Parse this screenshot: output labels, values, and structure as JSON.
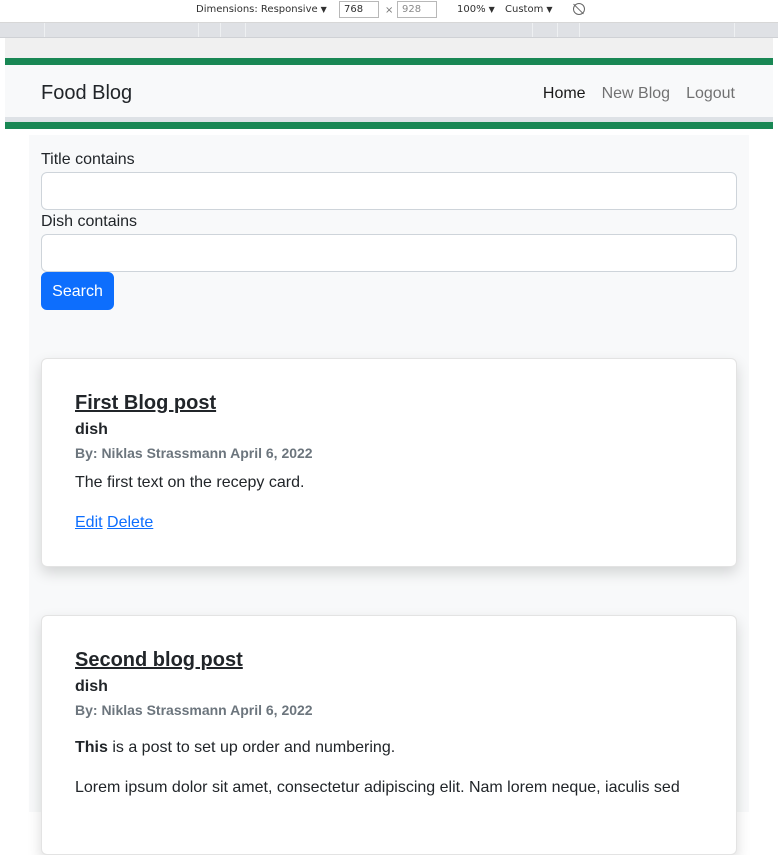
{
  "devtools": {
    "dimensions_label": "Dimensions: Responsive",
    "width_value": "768",
    "height_value": "928",
    "times": "×",
    "zoom": "100%",
    "throttle": "Custom"
  },
  "nav": {
    "brand": "Food Blog",
    "links": [
      "Home",
      "New Blog",
      "Logout"
    ]
  },
  "search": {
    "title_label": "Title contains",
    "title_value": "",
    "dish_label": "Dish contains",
    "dish_value": "",
    "button": "Search"
  },
  "posts": [
    {
      "title": "First Blog post",
      "dish": "dish",
      "meta": "By: Niklas Strassmann April 6, 2022",
      "body": "The first text on the recepy card.",
      "edit": "Edit",
      "delete": "Delete"
    },
    {
      "title": "Second blog post",
      "dish": "dish",
      "meta": "By: Niklas Strassmann April 6, 2022",
      "body_bold": "This",
      "body_rest": " is a post to set up order and numbering.",
      "lorem": "Lorem ipsum dolor sit amet, consectetur adipiscing elit. Nam lorem neque, iaculis sed"
    }
  ],
  "colors": {
    "accent_green": "#198754",
    "primary": "#0d6efd"
  }
}
